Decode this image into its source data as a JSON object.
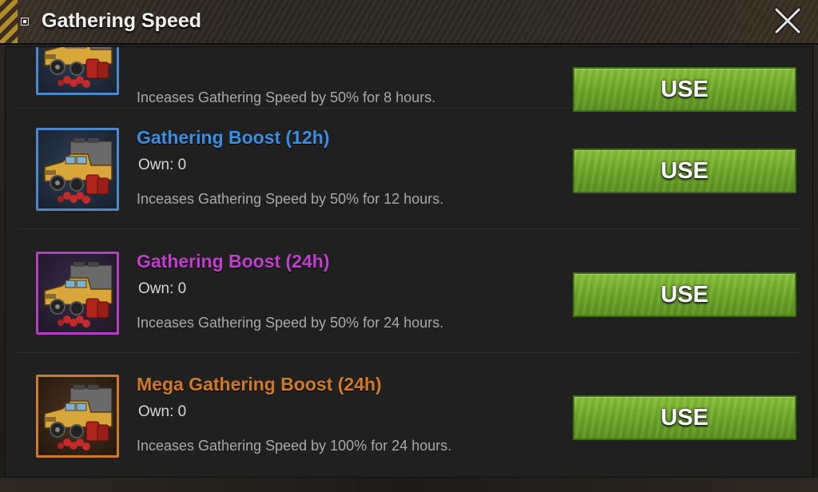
{
  "window": {
    "title": "Gathering Speed",
    "accent_color": "#7cb83a"
  },
  "items": [
    {
      "name": "",
      "own": "",
      "description": "Inceases Gathering Speed by 50% for 8 hours.",
      "button": "USE",
      "name_color": "#3a8fe0",
      "border_color": "#4d87c7",
      "icon": "truck-icon"
    },
    {
      "name": "Gathering Boost (12h)",
      "own": "Own: 0",
      "description": "Inceases Gathering Speed by 50% for 12 hours.",
      "button": "USE",
      "name_color": "#3a8fe0",
      "border_color": "#4d87c7",
      "icon": "truck-icon"
    },
    {
      "name": "Gathering Boost (24h)",
      "own": "Own: 0",
      "description": "Inceases Gathering Speed by 50% for 24 hours.",
      "button": "USE",
      "name_color": "#c13fcf",
      "border_color": "#b23fc0",
      "icon": "truck-icon"
    },
    {
      "name": "Mega Gathering Boost (24h)",
      "own": "Own: 0",
      "description": "Inceases Gathering Speed by 100% for 24 hours.",
      "button": "USE",
      "name_color": "#d07a28",
      "border_color": "#d07a28",
      "icon": "truck-icon"
    }
  ]
}
